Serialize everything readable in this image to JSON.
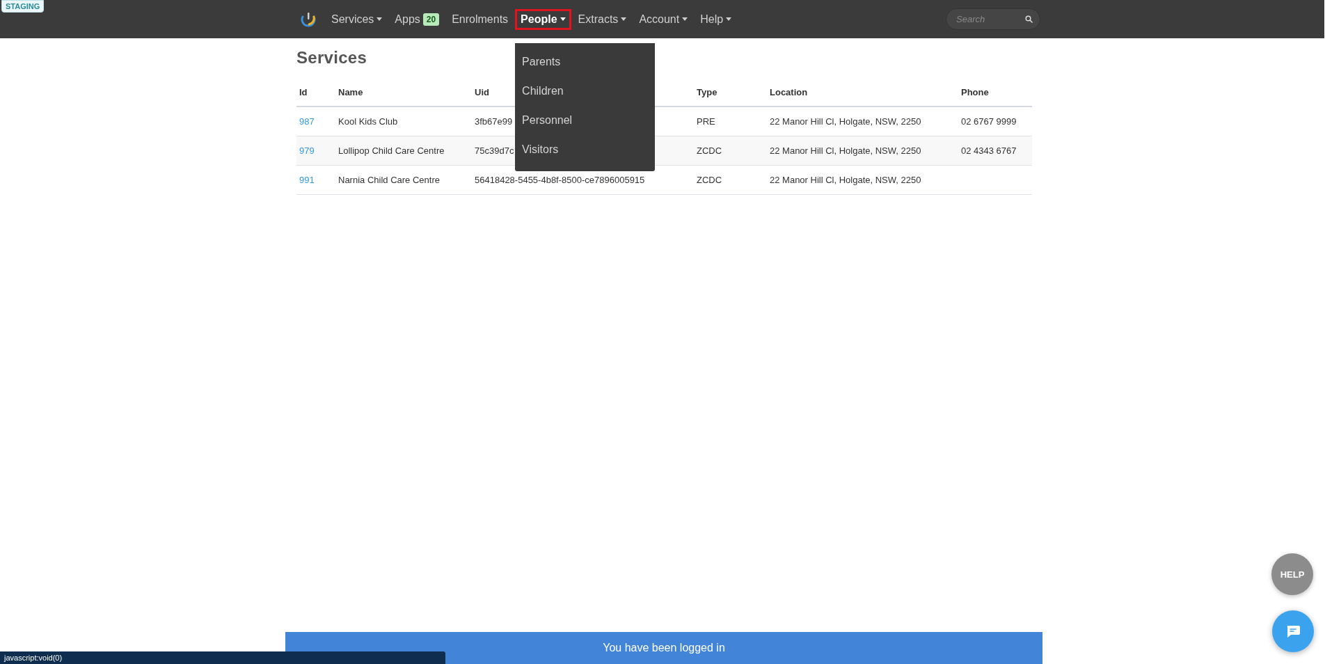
{
  "environment_badge": "STAGING",
  "nav": {
    "items": [
      {
        "label": "Services",
        "has_menu": true,
        "selected": false
      },
      {
        "label": "Apps",
        "badge": "20",
        "has_menu": false,
        "selected": false
      },
      {
        "label": "Enrolments",
        "has_menu": false,
        "selected": false
      },
      {
        "label": "People",
        "has_menu": true,
        "selected": true,
        "menu": [
          "Parents",
          "Children",
          "Personnel",
          "Visitors"
        ]
      },
      {
        "label": "Extracts",
        "has_menu": true,
        "selected": false
      },
      {
        "label": "Account",
        "has_menu": true,
        "selected": false
      },
      {
        "label": "Help",
        "has_menu": true,
        "selected": false
      }
    ],
    "search": {
      "placeholder": "Search"
    }
  },
  "page": {
    "title": "Services",
    "table": {
      "columns": [
        "Id",
        "Name",
        "Uid",
        "Type",
        "Location",
        "Phone"
      ],
      "rows": [
        {
          "id": "987",
          "name": "Kool Kids Club",
          "uid": "3fb67e99",
          "type": "PRE",
          "location": "22 Manor Hill Cl, Holgate, NSW, 2250",
          "phone": "02 6767 9999"
        },
        {
          "id": "979",
          "name": "Lollipop Child Care Centre",
          "uid": "75c39d7c",
          "type": "ZCDC",
          "location": "22 Manor Hill Cl, Holgate, NSW, 2250",
          "phone": "02 4343 6767"
        },
        {
          "id": "991",
          "name": "Narnia Child Care Centre",
          "uid": "56418428-5455-4b8f-8500-ce7896005915",
          "type": "ZCDC",
          "location": "22 Manor Hill Cl, Holgate, NSW, 2250"
        }
      ]
    }
  },
  "help_button": "HELP",
  "notification": "You have been logged in",
  "status_bar": "javascript:void(0)"
}
